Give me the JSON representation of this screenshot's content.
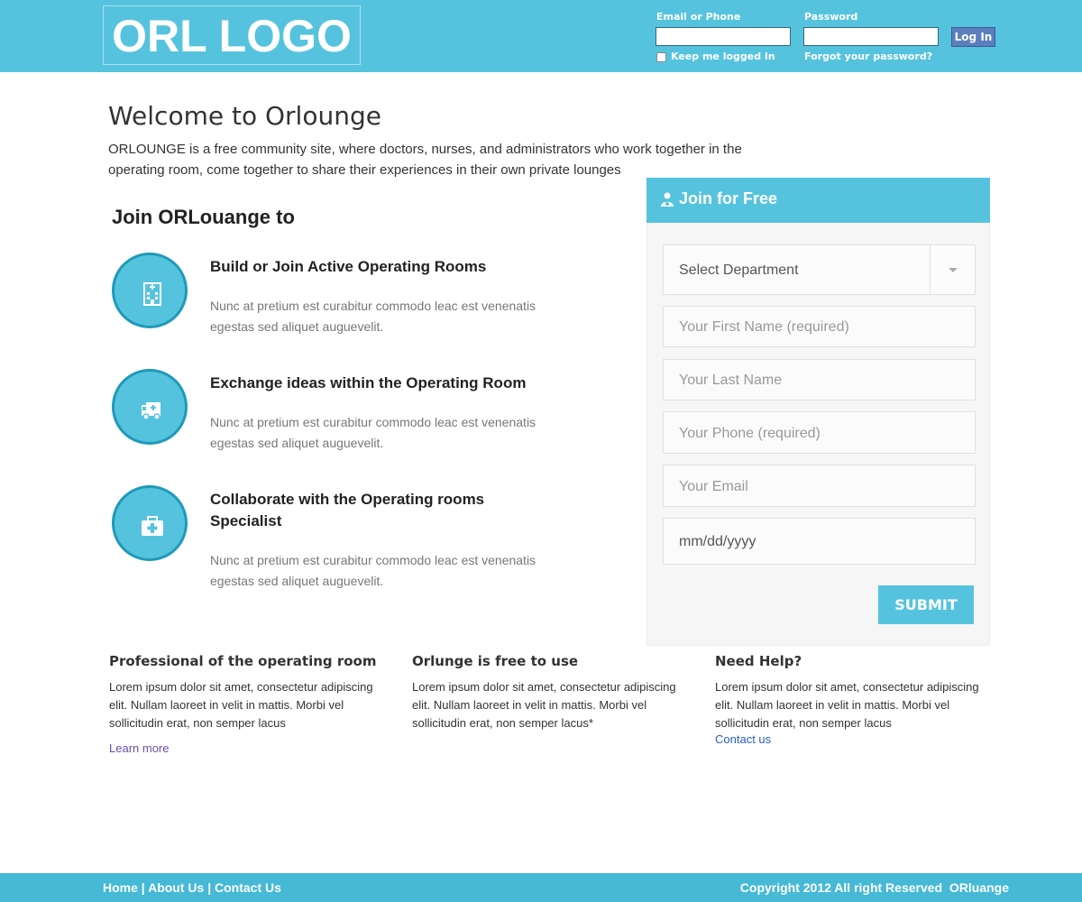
{
  "header": {
    "logo": "ORL LOGO",
    "email_label": "Email or Phone",
    "password_label": "Password",
    "keep_logged": "Keep me logged in",
    "forgot": "Forgot your password?",
    "login_button": "Log In",
    "accent_color": "#56c3de",
    "login_button_color": "#5b7fbd"
  },
  "intro": {
    "title": "Welcome to Orlounge",
    "text": "ORLOUNGE is a free community site, where doctors, nurses, and administrators who work together in the operating room, come together to share their experiences in their own private lounges"
  },
  "features": {
    "heading": "Join ORLouange to",
    "items": [
      {
        "icon": "hospital-building-icon",
        "title": "Build or Join Active Operating Rooms",
        "desc": "Nunc at pretium est curabitur commodo leac est venenatis egestas sed aliquet auguevelit."
      },
      {
        "icon": "ambulance-icon",
        "title": "Exchange ideas within the Operating Room",
        "desc": "Nunc at pretium est curabitur commodo leac est venenatis egestas sed aliquet auguevelit."
      },
      {
        "icon": "medkit-icon",
        "title": "Collaborate with the Operating rooms Specialist",
        "desc": "Nunc at pretium est curabitur commodo leac est venenatis egestas sed aliquet auguevelit."
      }
    ]
  },
  "join_form": {
    "title": "Join for Free",
    "department": "Select Department",
    "first_name": "Your First Name (required)",
    "last_name": "Your Last Name",
    "phone": "Your Phone (required)",
    "email": "Your Email",
    "date": "mm/dd/yyyy",
    "submit": "SUBMIT"
  },
  "columns": [
    {
      "title": "Professional of the operating room",
      "text": "Lorem ipsum dolor sit amet, consectetur adipiscing elit. Nullam laoreet in velit in mattis. Morbi vel sollicitudin erat, non semper lacus",
      "link": "Learn more"
    },
    {
      "title": "Orlunge is free to use",
      "text": "Lorem ipsum dolor sit amet, consectetur adipiscing elit. Nullam laoreet in velit in mattis. Morbi vel sollicitudin erat, non semper lacus*"
    },
    {
      "title": "Need Help?",
      "text": "Lorem ipsum dolor sit amet, consectetur adipiscing elit. Nullam laoreet in velit in mattis. Morbi vel sollicitudin erat, non semper lacus",
      "link": "Contact us"
    }
  ],
  "footer": {
    "home": "Home",
    "sep1": "|",
    "about": "About Us",
    "sep2": "|",
    "contact": "Contact Us",
    "copyright": "Copyright 2012 All right Reserved  ORluange"
  }
}
